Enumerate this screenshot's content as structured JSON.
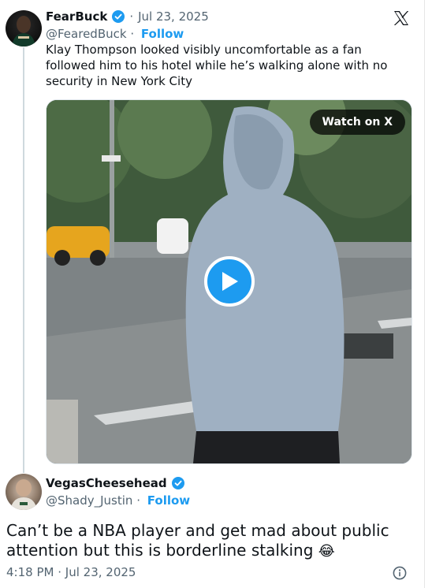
{
  "quoted_tweet": {
    "display_name": "FearBuck",
    "handle": "@FearedBuck",
    "separator": "·",
    "date": "Jul 23, 2025",
    "follow_label": "Follow",
    "text": "Klay Thompson looked visibly uncomfortable as a fan followed him to his hotel while he’s walking alone with no security in New York City",
    "media": {
      "watch_label": "Watch on X",
      "icon": "play-icon"
    }
  },
  "main_tweet": {
    "display_name": "VegasCheesehead",
    "handle": "@Shady_Justin",
    "separator": "·",
    "follow_label": "Follow",
    "text": "Can’t be a NBA player and get mad about public attention but this is borderline stalking",
    "emoji": "😂",
    "time": "4:18 PM",
    "date": "Jul 23, 2025"
  },
  "icons": {
    "verified": "verified-badge-icon",
    "x_logo": "x-logo-icon",
    "info": "info-icon"
  },
  "colors": {
    "accent": "#1d9bf0",
    "text": "#0f1419",
    "muted": "#536471"
  }
}
